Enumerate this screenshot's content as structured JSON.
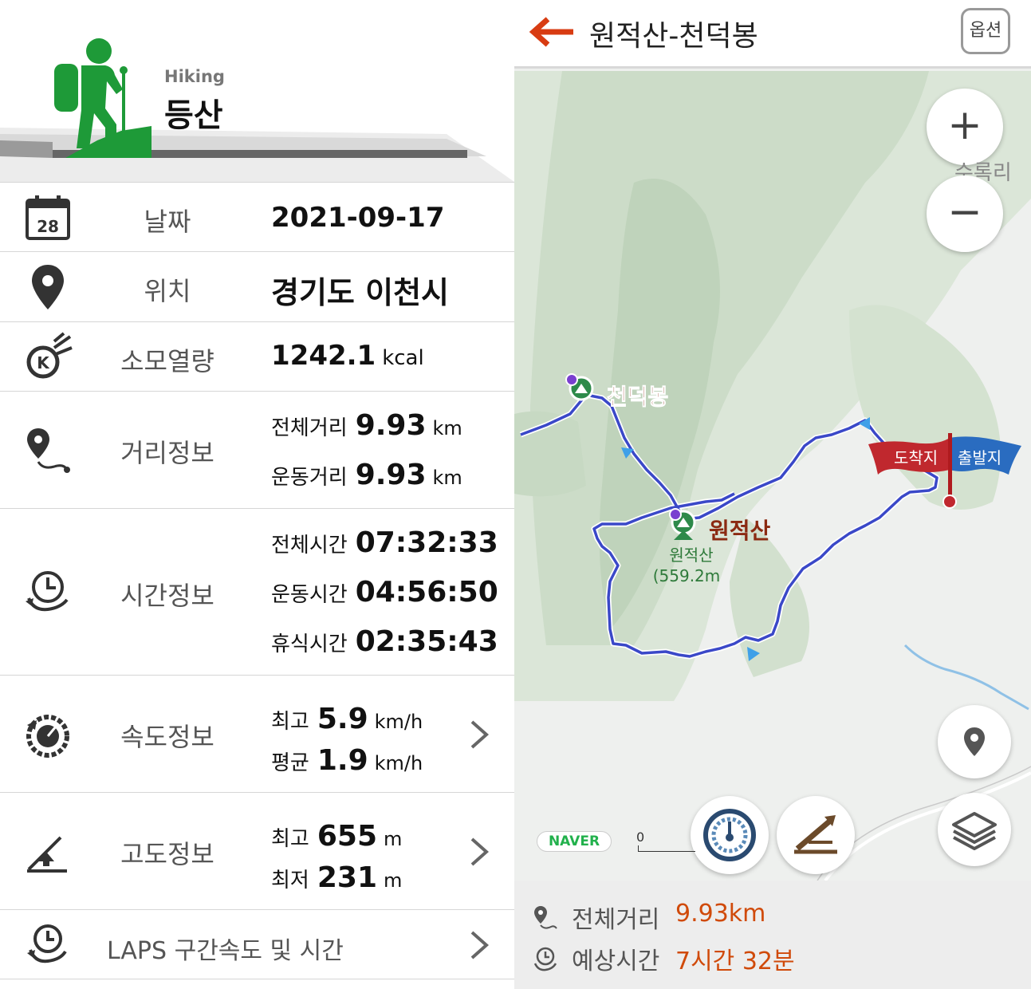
{
  "activity": {
    "en": "Hiking",
    "ko": "등산"
  },
  "date": {
    "label": "날짜",
    "value": "2021-09-17",
    "calendar_day": "28"
  },
  "location": {
    "label": "위치",
    "value": "경기도 이천시"
  },
  "calories": {
    "label": "소모열량",
    "value": "1242.1",
    "unit": "kcal"
  },
  "distance": {
    "label": "거리정보",
    "total": {
      "key": "전체거리",
      "value": "9.93",
      "unit": "km"
    },
    "moving": {
      "key": "운동거리",
      "value": "9.93",
      "unit": "km"
    }
  },
  "time": {
    "label": "시간정보",
    "total": {
      "key": "전체시간",
      "value": "07:32:33"
    },
    "moving": {
      "key": "운동시간",
      "value": "04:56:50"
    },
    "rest": {
      "key": "휴식시간",
      "value": "02:35:43"
    }
  },
  "speed": {
    "label": "속도정보",
    "max": {
      "key": "최고",
      "value": "5.9",
      "unit": "km/h"
    },
    "avg": {
      "key": "평균",
      "value": "1.9",
      "unit": "km/h"
    }
  },
  "altitude": {
    "label": "고도정보",
    "max": {
      "key": "최고",
      "value": "655",
      "unit": "m"
    },
    "min": {
      "key": "최저",
      "value": "231",
      "unit": "m"
    }
  },
  "laps": {
    "label": "LAPS 구간속도 및 시간"
  },
  "map": {
    "title": "원적산-천덕봉",
    "options_label": "옵션",
    "zoom_in": "+",
    "zoom_out": "−",
    "place_label": "수록리",
    "peak1_name": "천덕봉",
    "peak2_name": "원적산",
    "peak2_caption_line1": "원적산",
    "peak2_caption_line2": "(559.2m",
    "arrival_flag": "도착지",
    "start_flag": "출발지",
    "naver_logo": "NAVER",
    "scale_zero": "0",
    "footer_distance": {
      "label": "전체거리",
      "value": "9.93km"
    },
    "footer_time": {
      "label": "예상시간",
      "value": "7시간 32분"
    }
  },
  "colors": {
    "hiker_green": "#1e9a38",
    "back_arrow": "#d83c12",
    "route": "#3a48c8",
    "peak_label": "#8b2a12",
    "footer_value": "#d04a0a",
    "arrival_flag": "#c0282e",
    "start_flag": "#2a6cc0"
  },
  "icons": [
    "calendar-icon",
    "location-pin-icon",
    "calorie-icon",
    "distance-icon",
    "clock-icon",
    "speedometer-icon",
    "altitude-icon",
    "laps-icon",
    "chevron-right-icon",
    "back-arrow-icon",
    "zoom-in-icon",
    "zoom-out-icon",
    "my-location-icon",
    "layers-icon",
    "speed-gauge-icon",
    "slope-icon"
  ]
}
